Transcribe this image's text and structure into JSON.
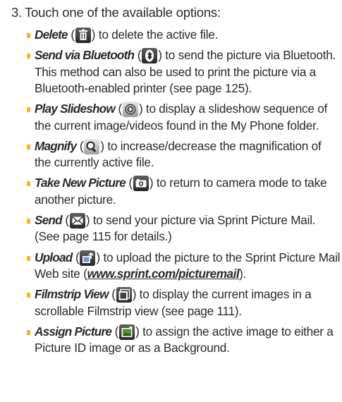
{
  "step": {
    "number": "3.",
    "text": "Touch one of the available options:"
  },
  "options": [
    {
      "term": "Delete",
      "icon": "trash-icon",
      "desc": ") to delete the active file."
    },
    {
      "term": "Send via Bluetooth",
      "icon": "bluetooth-icon",
      "desc": ") to send the picture via Bluetooth. This method can also be used to print the picture via a Bluetooth-enabled printer (see page 125)."
    },
    {
      "term": "Play Slideshow",
      "icon": "play-icon",
      "desc": ") to display a slideshow sequence of the current image/videos found in the My Phone folder."
    },
    {
      "term": "Magnify",
      "icon": "magnify-icon",
      "desc": ") to increase/decrease the magnification of the currently active file."
    },
    {
      "term": "Take New Picture",
      "icon": "camera-icon",
      "desc": ") to return to camera mode to take another picture."
    },
    {
      "term": "Send",
      "icon": "envelope-icon",
      "desc": ") to send your picture via Sprint Picture Mail. (See page 115 for details.)"
    },
    {
      "term": "Upload",
      "icon": "upload-icon",
      "desc_before_link": ") to upload the picture to the Sprint Picture Mail Web site (",
      "link": "www.sprint.com/picturemail",
      "desc_after_link": ")."
    },
    {
      "term": "Filmstrip View",
      "icon": "filmstrip-icon",
      "desc": ") to display the current images in a scrollable Filmstrip view (see page 111)."
    },
    {
      "term": "Assign Picture",
      "icon": "assign-picture-icon",
      "desc": ") to assign the active image to either a Picture ID image or as a Background."
    }
  ],
  "open_paren": " (",
  "colors": {
    "bullet": "#f6b81d",
    "text": "#2b2b2b",
    "icon_bg": "#3a3a3a"
  }
}
